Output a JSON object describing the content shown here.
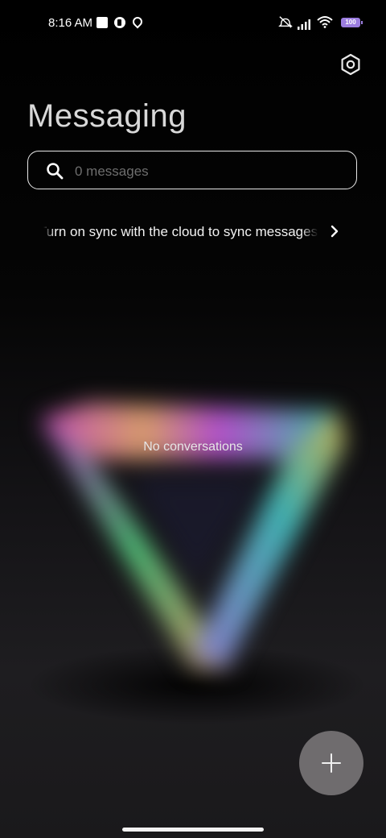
{
  "status_bar": {
    "time": "8:16 AM",
    "battery": "100"
  },
  "header": {
    "title": "Messaging",
    "settings_icon": "settings-hexagon-icon"
  },
  "search": {
    "placeholder": "0 messages",
    "value": ""
  },
  "sync_banner": {
    "text": "Turn on sync with the cloud to sync messages"
  },
  "empty_state": {
    "text": "No conversations"
  },
  "fab": {
    "icon": "plus-icon"
  }
}
